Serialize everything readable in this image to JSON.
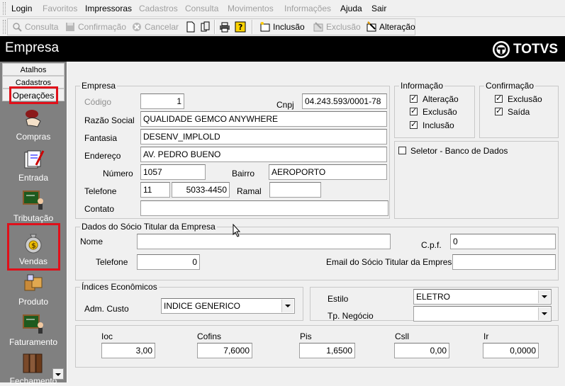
{
  "menu": [
    {
      "label": "Login",
      "enabled": true
    },
    {
      "label": "Favoritos",
      "enabled": false
    },
    {
      "label": "Impressoras",
      "enabled": true
    },
    {
      "label": "Cadastros",
      "enabled": false
    },
    {
      "label": "Consulta",
      "enabled": false
    },
    {
      "label": "Movimentos",
      "enabled": false
    },
    {
      "label": "Informações",
      "enabled": false
    },
    {
      "label": "Ajuda",
      "enabled": true
    },
    {
      "label": "Sair",
      "enabled": true
    }
  ],
  "toolbar": {
    "consulta": "Consulta",
    "confirmacao": "Confirmação",
    "cancelar": "Cancelar",
    "inclusao": "Inclusão",
    "exclusao": "Exclusão",
    "alteracao": "Alteração"
  },
  "window_title": "Empresa",
  "brand": "TOTVS",
  "sidebar": {
    "tabs": [
      "Atalhos",
      "Cadastros",
      "Operações"
    ],
    "items": [
      "Compras",
      "Entrada",
      "Tributação",
      "Vendas",
      "Produto",
      "Faturamento",
      "Fechamento"
    ]
  },
  "empresa": {
    "group_label": "Empresa",
    "codigo_label": "Código",
    "codigo": "1",
    "cnpj_label": "Cnpj",
    "cnpj": "04.243.593/0001-78",
    "razao_label": "Razão Social",
    "razao": "QUALIDADE GEMCO ANYWHERE",
    "fantasia_label": "Fantasia",
    "fantasia": "DESENV_IMPLOLD",
    "endereco_label": "Endereço",
    "endereco": "AV. PEDRO BUENO",
    "numero_label": "Número",
    "numero": "1057",
    "bairro_label": "Bairro",
    "bairro": "AEROPORTO",
    "telefone_label": "Telefone",
    "ddd": "11",
    "telefone": "5033-4450",
    "ramal_label": "Ramal",
    "ramal": "",
    "contato_label": "Contato",
    "contato": ""
  },
  "informacao": {
    "label": "Informação",
    "items": [
      {
        "label": "Alteração",
        "checked": true
      },
      {
        "label": "Exclusão",
        "checked": true
      },
      {
        "label": "Inclusão",
        "checked": true
      }
    ]
  },
  "confirmacao": {
    "label": "Confirmação",
    "items": [
      {
        "label": "Exclusão",
        "checked": true
      },
      {
        "label": "Saída",
        "checked": true
      }
    ]
  },
  "seletor": {
    "label": "Seletor - Banco de Dados",
    "checked": false
  },
  "socio": {
    "group_label": "Dados do Sócio Titular da Empresa",
    "nome_label": "Nome",
    "nome": "",
    "cpf_label": "C.p.f.",
    "cpf": "0",
    "telefone_label": "Telefone",
    "telefone": "0",
    "email_label": "Email do Sócio Titular da Empresa",
    "email": ""
  },
  "indices": {
    "group_label": "Índices Econômicos",
    "adm_label": "Adm. Custo",
    "adm": "INDICE GENERICO"
  },
  "estilo": {
    "estilo_label": "Estilo",
    "estilo": "ELETRO",
    "negocio_label": "Tp. Negócio",
    "negocio": ""
  },
  "taxes": {
    "ioc_label": "Ioc",
    "ioc": "3,00",
    "cofins_label": "Cofins",
    "cofins": "7,6000",
    "pis_label": "Pis",
    "pis": "1,6500",
    "csll_label": "Csll",
    "csll": "0,00",
    "ir_label": "Ir",
    "ir": "0,0000"
  }
}
